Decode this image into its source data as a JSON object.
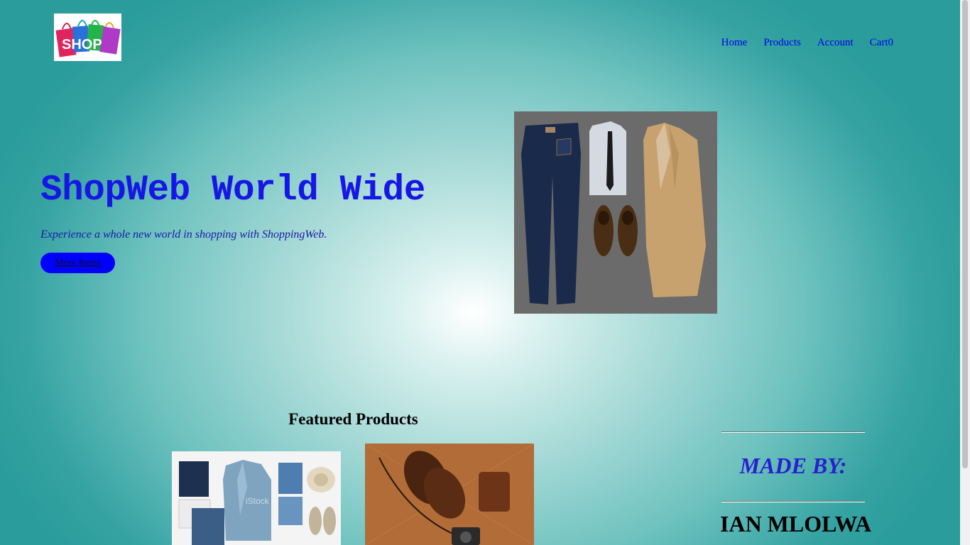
{
  "header": {
    "logo_text": "SHOP",
    "nav": [
      {
        "label": "Home"
      },
      {
        "label": "Products"
      },
      {
        "label": "Account"
      },
      {
        "label": "Cart0"
      }
    ]
  },
  "hero": {
    "title": "ShopWeb World Wide",
    "subtitle": "Experience a whole new world in shopping with ShoppingWeb.",
    "button_label": "More Items"
  },
  "featured": {
    "heading": "Featured Products",
    "watermark": "iStock"
  },
  "credits": {
    "label": "MADE BY:",
    "name": "IAN MLOLWA"
  },
  "colors": {
    "accent_blue": "#0000ff",
    "title_blue": "#1717e5",
    "teal_background": "#35a3a2"
  }
}
